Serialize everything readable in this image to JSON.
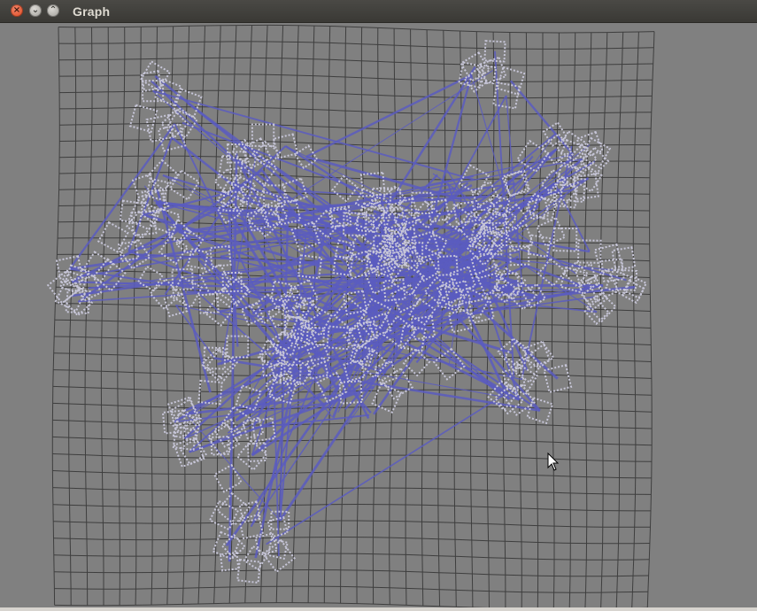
{
  "window": {
    "title": "Graph",
    "close_glyph": "×",
    "minimize_glyph": "⌄",
    "maximize_glyph": "⌃"
  },
  "graph": {
    "grid_color": "#3e3e3e",
    "node_color": "#c7c6d8",
    "edge_color": "#5a5cc0",
    "background": "#808080"
  },
  "icons": {
    "close": "close-icon",
    "minimize": "chevron-down-icon",
    "maximize": "chevron-up-icon",
    "cursor": "mouse-pointer-icon"
  }
}
